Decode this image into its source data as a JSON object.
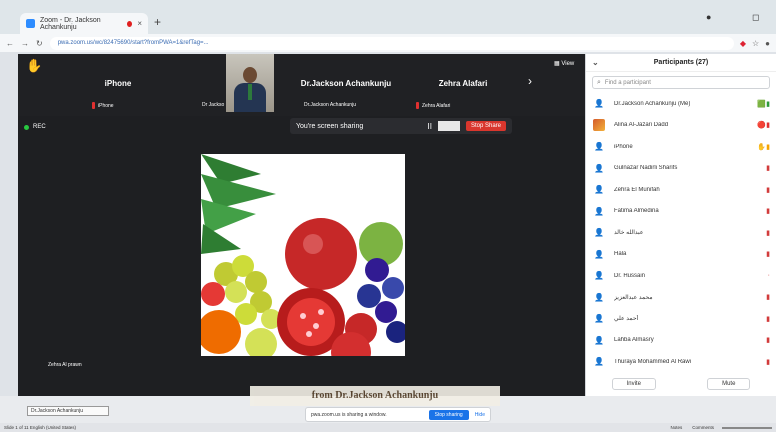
{
  "browser": {
    "tab_title": "Zoom - Dr. Jackson Achankunju",
    "close_glyph": "×",
    "newtab_glyph": "+",
    "url": "pwa.zoom.us/wc/82475690/start?fromPWA=1&refTag=...",
    "minimize_glyph": "●",
    "maximize_glyph": "◻"
  },
  "strip": {
    "tiles": [
      {
        "name": "iPhone",
        "sub": "iPhone"
      },
      {
        "name": "",
        "sub": "Dr Jackso"
      },
      {
        "name": "Dr.Jackson Achankunju",
        "sub": "Dr.Jackson Achankunju"
      },
      {
        "name": "Zehra Alafari",
        "sub": "Zehra Alafari"
      }
    ],
    "view_label": "View",
    "chevron_glyph": "›"
  },
  "recording": {
    "label": "REC"
  },
  "share_bar": {
    "text": "You're screen sharing",
    "pause_glyph": "II",
    "stop_label": "Stop Share"
  },
  "caption": "Zehra Al prawn",
  "panel": {
    "title": "Participants (27)",
    "search_placeholder": "Find a participant",
    "participants": [
      {
        "name": "Dr.Jackson Achankunju (Me)",
        "status": "🟩▮"
      },
      {
        "name": "Alina Al-Jazari Dadd",
        "status": "🔴▮"
      },
      {
        "name": "iPhone",
        "status": "✋▮"
      },
      {
        "name": "Gulnazar Nadirli Sharifs",
        "status": "▮"
      },
      {
        "name": "Zehra El Munifah",
        "status": "▮"
      },
      {
        "name": "Fatima Almedina",
        "status": "▮"
      },
      {
        "name": "عبدالله خالد",
        "status": "▮"
      },
      {
        "name": "Hala",
        "status": "▮"
      },
      {
        "name": "Dr. Hussain",
        "status": "·"
      },
      {
        "name": "محمد عبدالعزيز",
        "status": "▮"
      },
      {
        "name": "أحمد علي",
        "status": "▮"
      },
      {
        "name": "Lahba Almasry",
        "status": "▮"
      },
      {
        "name": "Thuraya Mohammed Al Rawi",
        "status": "▮"
      }
    ],
    "invite_label": "Invite",
    "mute_label": "Mute"
  },
  "bottom": {
    "doc_title": "from Dr.Jackson Achankunju",
    "smallbox": "Dr.Jackson Achankunju",
    "notice_text": "pwa.zoom.us is sharing a window.",
    "stop_sharing": "Stop sharing",
    "hide": "Hide"
  },
  "status_bar": {
    "left": "Slide 1 of 11    English (United States)",
    "right": [
      "Notes",
      "Comments"
    ]
  }
}
